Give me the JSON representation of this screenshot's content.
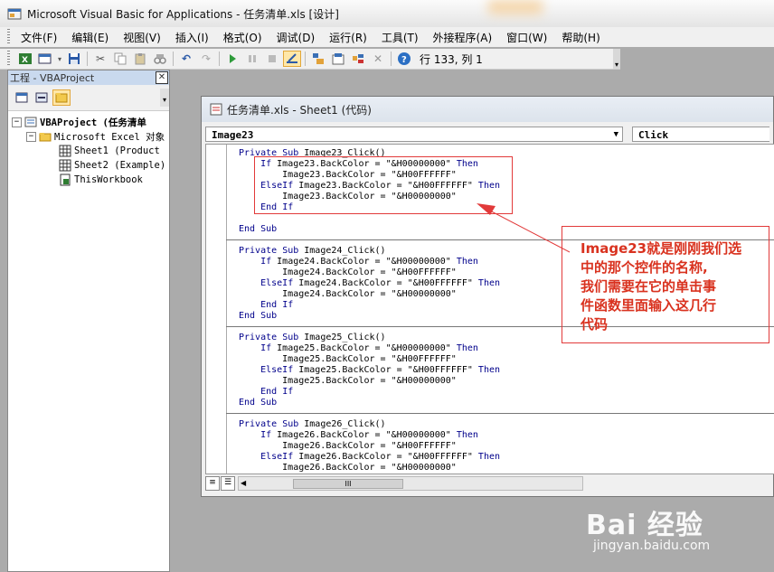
{
  "window": {
    "title": "Microsoft Visual Basic for Applications - 任务清单.xls [设计]"
  },
  "menubar": {
    "items": [
      {
        "label": "文件(F)"
      },
      {
        "label": "编辑(E)"
      },
      {
        "label": "视图(V)"
      },
      {
        "label": "插入(I)"
      },
      {
        "label": "格式(O)"
      },
      {
        "label": "调试(D)"
      },
      {
        "label": "运行(R)"
      },
      {
        "label": "工具(T)"
      },
      {
        "label": "外接程序(A)"
      },
      {
        "label": "窗口(W)"
      },
      {
        "label": "帮助(H)"
      }
    ]
  },
  "toolbar": {
    "cursor_position": "行 133, 列 1",
    "icons": [
      "excel-icon",
      "insert-userform-icon",
      "save-icon",
      "cut-icon",
      "copy-icon",
      "paste-icon",
      "find-icon",
      "undo-icon",
      "redo-icon",
      "run-icon",
      "break-icon",
      "reset-icon",
      "design-mode-icon",
      "project-explorer-icon",
      "properties-icon",
      "object-browser-icon",
      "toolbox-icon",
      "help-icon"
    ]
  },
  "project_panel": {
    "title": "工程 - VBAProject",
    "close_label": "✕",
    "tree": {
      "root": "VBAProject (任务清单",
      "folder": "Microsoft Excel 对象",
      "items": [
        {
          "label": "Sheet1 (Product"
        },
        {
          "label": "Sheet2 (Example)"
        },
        {
          "label": "ThisWorkbook"
        }
      ]
    }
  },
  "code_window": {
    "title": "任务清单.xls - Sheet1 (代码)",
    "object_combo": "Image23",
    "procedure_combo": "Click",
    "procedures": [
      {
        "lines": [
          "Private Sub Image23_Click()",
          "    If Image23.BackColor = \"&H00000000\" Then",
          "        Image23.BackColor = \"&H00FFFFFF\"",
          "    ElseIf Image23.BackColor = \"&H00FFFFFF\" Then",
          "        Image23.BackColor = \"&H00000000\"",
          "    End If",
          "",
          "End Sub"
        ]
      },
      {
        "lines": [
          "Private Sub Image24_Click()",
          "    If Image24.BackColor = \"&H00000000\" Then",
          "        Image24.BackColor = \"&H00FFFFFF\"",
          "    ElseIf Image24.BackColor = \"&H00FFFFFF\" Then",
          "        Image24.BackColor = \"&H00000000\"",
          "    End If",
          "End Sub"
        ]
      },
      {
        "lines": [
          "Private Sub Image25_Click()",
          "    If Image25.BackColor = \"&H00000000\" Then",
          "        Image25.BackColor = \"&H00FFFFFF\"",
          "    ElseIf Image25.BackColor = \"&H00FFFFFF\" Then",
          "        Image25.BackColor = \"&H00000000\"",
          "    End If",
          "End Sub"
        ]
      },
      {
        "lines": [
          "Private Sub Image26_Click()",
          "    If Image26.BackColor = \"&H00000000\" Then",
          "        Image26.BackColor = \"&H00FFFFFF\"",
          "    ElseIf Image26.BackColor = \"&H00FFFFFF\" Then",
          "        Image26.BackColor = \"&H00000000\""
        ]
      }
    ]
  },
  "annotation": {
    "lines": [
      "Image23就是刚刚我们选",
      "中的那个控件的名称,",
      "我们需要在它的单击事",
      "件函数里面输入这几行",
      "代码"
    ],
    "color": "#d9321f"
  },
  "watermark": {
    "main": "Bai 经验",
    "sub": "jingyan.baidu.com"
  },
  "colors": {
    "keyword": "#00008b",
    "annotation_red": "#e23a3a",
    "workspace": "#ababab"
  }
}
